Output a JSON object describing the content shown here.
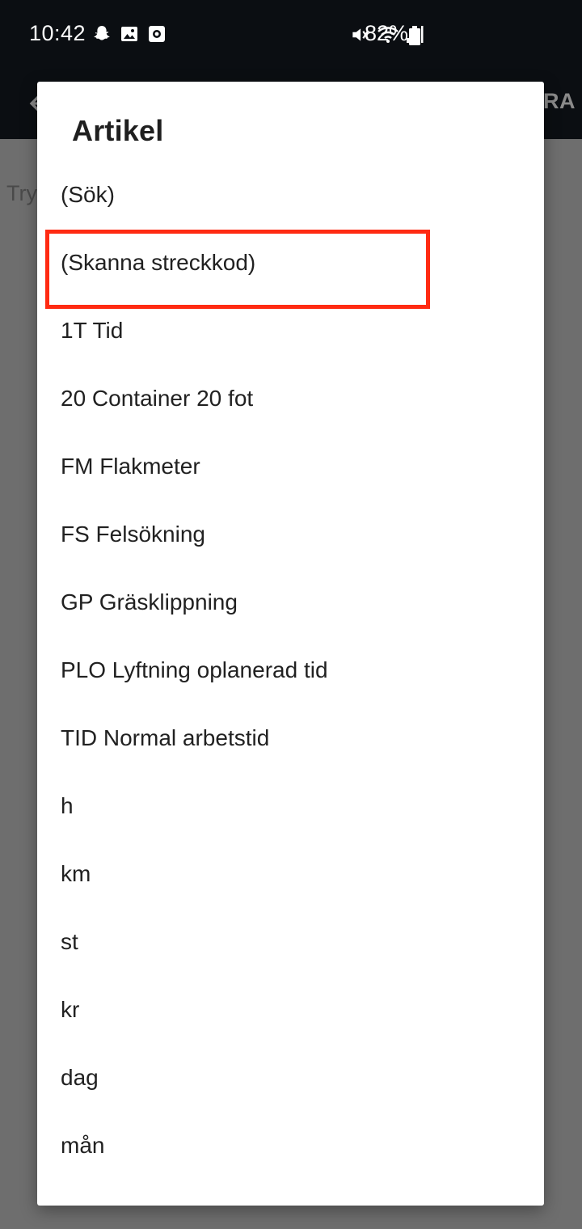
{
  "status_bar": {
    "time": "10:42",
    "battery": "82%",
    "left_icons": [
      "snapchat-icon",
      "gallery-icon",
      "screen-record-icon"
    ],
    "right_icons": [
      "mute-icon",
      "wifi-icon",
      "signal-icon",
      "battery-icon"
    ]
  },
  "app_bar": {
    "back_icon": "arrow-left-icon",
    "action_label": "RA"
  },
  "background": {
    "hint_text": "Try"
  },
  "dialog": {
    "title": "Artikel",
    "items": [
      {
        "label": "(Sök)"
      },
      {
        "label": "(Skanna streckkod)",
        "highlighted": true
      },
      {
        "label": "1T Tid"
      },
      {
        "label": "20 Container 20 fot"
      },
      {
        "label": "FM Flakmeter"
      },
      {
        "label": "FS Felsökning"
      },
      {
        "label": "GP Gräsklippning"
      },
      {
        "label": "PLO Lyftning oplanerad tid"
      },
      {
        "label": "TID Normal arbetstid"
      },
      {
        "label": "h"
      },
      {
        "label": "km"
      },
      {
        "label": "st"
      },
      {
        "label": "kr"
      },
      {
        "label": "dag"
      },
      {
        "label": "mån"
      }
    ]
  },
  "colors": {
    "highlight": "#ff2a12",
    "status_bar_bg": "#0b0e12",
    "scrim": "#6e6e6e",
    "dialog_bg": "#ffffff"
  }
}
